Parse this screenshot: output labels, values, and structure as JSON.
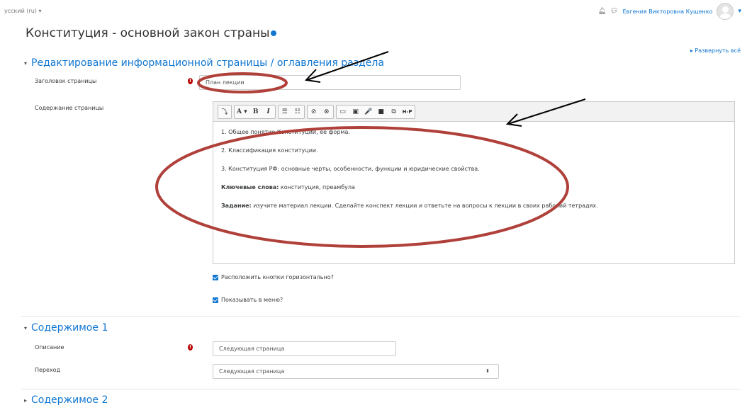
{
  "topbar": {
    "language": "усский (ru)",
    "user_name": "Евгения Викторовна Кущенко"
  },
  "page": {
    "title": "Конституция - основной закон страны",
    "expand_all": "Развернуть всё"
  },
  "section_edit": {
    "title": "Редактирование информационной страницы / оглавления раздела",
    "page_title_label": "Заголовок страницы",
    "page_title_value": "План лекции",
    "content_label": "Содержание страницы",
    "toolbar": [
      "⤵",
      "A ▾",
      "B",
      "I",
      "☰",
      "☷",
      "⊘",
      "⊗",
      "▭",
      "▣",
      "🎤",
      "■",
      "⧉",
      "H-P"
    ],
    "content": {
      "line1": "1. Общее понятие Конституции, ее форма.",
      "line2": "2. Классификация конституции.",
      "line3": "3. Конституция РФ: основные черты, особенности, функции и юридические свойства.",
      "keywords_label": "Ключевые слова:",
      "keywords_text": " конституция, преамбула",
      "task_label": "Задание:",
      "task_text": " изучите материал лекции. Сделайте конспект лекции и ответьте на вопросы к лекции в своих рабочий тетрадях."
    },
    "checkbox_horizontal": "Расположить кнопки горизонтально?",
    "checkbox_menu": "Показывать в меню?"
  },
  "section_content1": {
    "title": "Содержимое 1",
    "description_label": "Описание",
    "description_value": "Следующая страница",
    "jump_label": "Переход",
    "jump_value": "Следующая страница"
  },
  "section_content2": {
    "title": "Содержимое 2"
  },
  "colors": {
    "accent": "#1177d1",
    "annotation": "#b0403a",
    "required": "#bb0000"
  }
}
